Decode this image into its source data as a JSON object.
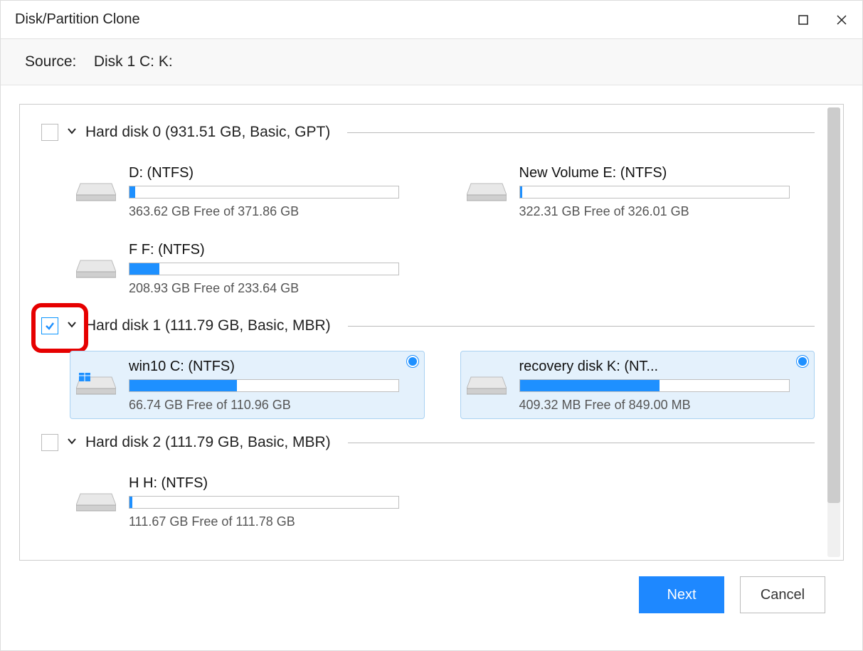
{
  "window": {
    "title": "Disk/Partition Clone"
  },
  "source": {
    "label": "Source:",
    "value": "Disk 1 C: K:"
  },
  "disks": [
    {
      "checked": false,
      "highlighted": false,
      "title": "Hard disk 0 (931.51 GB, Basic, GPT)",
      "partitions": [
        {
          "name": "D: (NTFS)",
          "usage": "363.62 GB Free of 371.86 GB",
          "fill_pct": 2,
          "selected": false,
          "icon": "disk"
        },
        {
          "name": "New Volume E: (NTFS)",
          "usage": "322.31 GB Free of 326.01 GB",
          "fill_pct": 1,
          "selected": false,
          "icon": "disk"
        },
        {
          "name": "F F: (NTFS)",
          "usage": "208.93 GB Free of 233.64 GB",
          "fill_pct": 11,
          "selected": false,
          "icon": "disk"
        }
      ]
    },
    {
      "checked": true,
      "highlighted": true,
      "title": "Hard disk 1 (111.79 GB, Basic, MBR)",
      "partitions": [
        {
          "name": "win10 C: (NTFS)",
          "usage": "66.74 GB Free of 110.96 GB",
          "fill_pct": 40,
          "selected": true,
          "icon": "windows-disk"
        },
        {
          "name": "recovery disk K: (NT...",
          "usage": "409.32 MB Free of 849.00 MB",
          "fill_pct": 52,
          "selected": true,
          "icon": "disk"
        }
      ]
    },
    {
      "checked": false,
      "highlighted": false,
      "title": "Hard disk 2 (111.79 GB, Basic, MBR)",
      "partitions": [
        {
          "name": "H H: (NTFS)",
          "usage": "111.67 GB Free of 111.78 GB",
          "fill_pct": 1,
          "selected": false,
          "icon": "disk"
        }
      ]
    }
  ],
  "footer": {
    "next": "Next",
    "cancel": "Cancel"
  }
}
